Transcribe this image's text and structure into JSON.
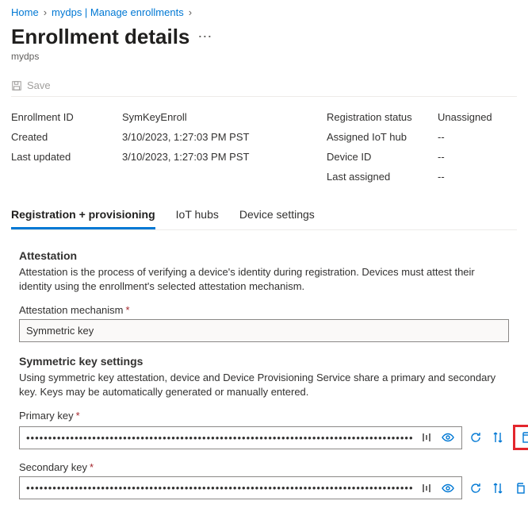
{
  "breadcrumb": {
    "items": [
      {
        "label": "Home"
      },
      {
        "label": "mydps | Manage enrollments"
      }
    ]
  },
  "page": {
    "title": "Enrollment details",
    "subtitle": "mydps"
  },
  "toolbar": {
    "save_label": "Save"
  },
  "details": {
    "left": [
      {
        "label": "Enrollment ID",
        "value": "SymKeyEnroll"
      },
      {
        "label": "Created",
        "value": "3/10/2023, 1:27:03 PM PST"
      },
      {
        "label": "Last updated",
        "value": "3/10/2023, 1:27:03 PM PST"
      }
    ],
    "right": [
      {
        "label": "Registration status",
        "value": "Unassigned"
      },
      {
        "label": "Assigned IoT hub",
        "value": "--"
      },
      {
        "label": "Device ID",
        "value": "--"
      },
      {
        "label": "Last assigned",
        "value": "--"
      }
    ]
  },
  "tabs": [
    {
      "label": "Registration + provisioning",
      "active": true
    },
    {
      "label": "IoT hubs",
      "active": false
    },
    {
      "label": "Device settings",
      "active": false
    }
  ],
  "attestation": {
    "heading": "Attestation",
    "description": "Attestation is the process of verifying a device's identity during registration. Devices must attest their identity using the enrollment's selected attestation mechanism.",
    "mechanism_label": "Attestation mechanism",
    "mechanism_value": "Symmetric key"
  },
  "symkey": {
    "heading": "Symmetric key settings",
    "description": "Using symmetric key attestation, device and Device Provisioning Service share a primary and secondary key. Keys may be automatically generated or manually entered.",
    "primary_label": "Primary key",
    "primary_value": "••••••••••••••••••••••••••••••••••••••••••••••••••••••••••••••••••••••••••••••••••••••••",
    "secondary_label": "Secondary key",
    "secondary_value": "••••••••••••••••••••••••••••••••••••••••••••••••••••••••••••••••••••••••••••••••••••••••"
  }
}
